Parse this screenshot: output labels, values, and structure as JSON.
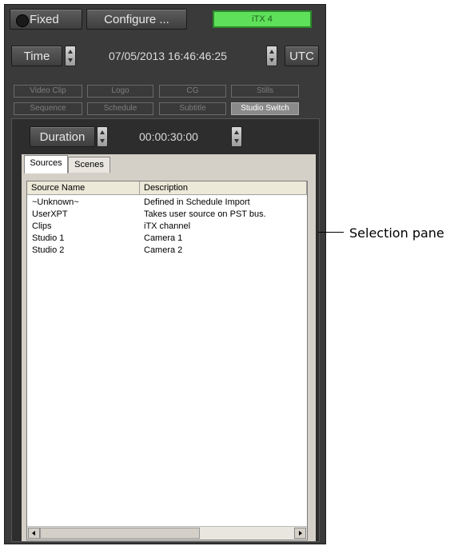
{
  "top_bar": {
    "fixed_label": "Fixed",
    "configure_label": "Configure ...",
    "channel_label": "iTX 4"
  },
  "time_bar": {
    "time_label": "Time",
    "datetime_value": "07/05/2013 16:46:46:25",
    "utc_label": "UTC"
  },
  "tabs_row1": [
    "Video Clip",
    "Logo",
    "CG",
    "Stills"
  ],
  "tabs_row2": [
    "Sequence",
    "Schedule",
    "Subtitle",
    "Studio Switch"
  ],
  "active_tab": "Studio Switch",
  "duration": {
    "label": "Duration",
    "value": "00:00:30:00"
  },
  "subtabs": [
    "Sources",
    "Scenes"
  ],
  "table": {
    "columns": [
      "Source Name",
      "Description"
    ],
    "rows": [
      [
        "~Unknown~",
        "Defined in Schedule Import"
      ],
      [
        "UserXPT",
        "Takes user source on PST bus."
      ],
      [
        "Clips",
        "iTX channel"
      ],
      [
        "Studio 1",
        "Camera 1"
      ],
      [
        "Studio 2",
        "Camera 2"
      ]
    ]
  },
  "callout": {
    "text": "Selection pane"
  }
}
